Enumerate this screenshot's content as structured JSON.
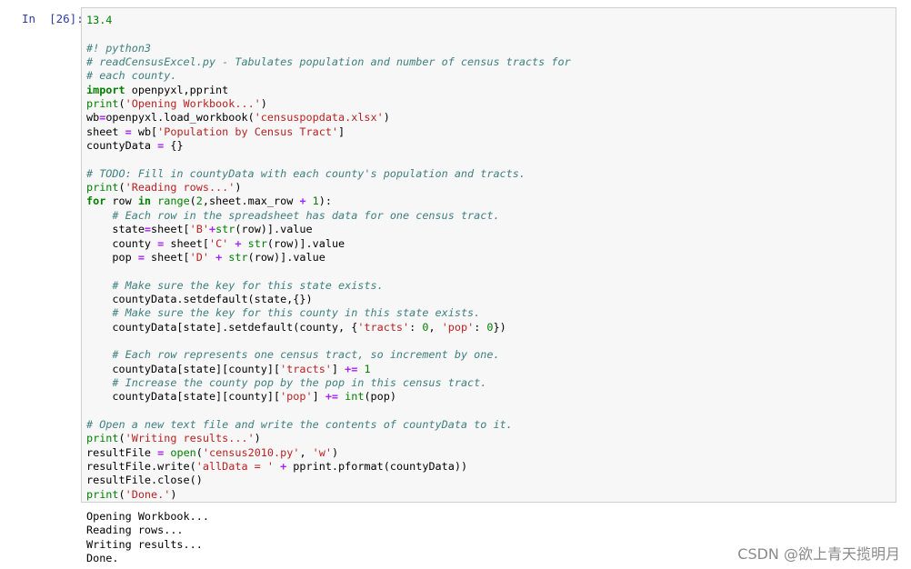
{
  "cell": {
    "prompt": "In  [26]:",
    "code_lines": [
      [
        {
          "t": "nu",
          "v": "13.4"
        }
      ],
      [],
      [
        {
          "t": "cm",
          "v": "#! python3"
        }
      ],
      [
        {
          "t": "cm",
          "v": "# readCensusExcel.py - Tabulates population and number of census tracts for"
        }
      ],
      [
        {
          "t": "cm",
          "v": "# each county."
        }
      ],
      [
        {
          "t": "kw",
          "v": "import"
        },
        {
          "t": "tx",
          "v": " openpyxl,pprint"
        }
      ],
      [
        {
          "t": "bi",
          "v": "print"
        },
        {
          "t": "tx",
          "v": "("
        },
        {
          "t": "st",
          "v": "'Opening Workbook...'"
        },
        {
          "t": "tx",
          "v": ")"
        }
      ],
      [
        {
          "t": "tx",
          "v": "wb"
        },
        {
          "t": "op",
          "v": "="
        },
        {
          "t": "tx",
          "v": "openpyxl.load_workbook("
        },
        {
          "t": "st",
          "v": "'censuspopdata.xlsx'"
        },
        {
          "t": "tx",
          "v": ")"
        }
      ],
      [
        {
          "t": "tx",
          "v": "sheet "
        },
        {
          "t": "op",
          "v": "="
        },
        {
          "t": "tx",
          "v": " wb["
        },
        {
          "t": "st",
          "v": "'Population by Census Tract'"
        },
        {
          "t": "tx",
          "v": "]"
        }
      ],
      [
        {
          "t": "tx",
          "v": "countyData "
        },
        {
          "t": "op",
          "v": "="
        },
        {
          "t": "tx",
          "v": " {}"
        }
      ],
      [],
      [
        {
          "t": "cm",
          "v": "# TODO: Fill in countyData with each county's population and tracts."
        }
      ],
      [
        {
          "t": "bi",
          "v": "print"
        },
        {
          "t": "tx",
          "v": "("
        },
        {
          "t": "st",
          "v": "'Reading rows...'"
        },
        {
          "t": "tx",
          "v": ")"
        }
      ],
      [
        {
          "t": "kw",
          "v": "for"
        },
        {
          "t": "tx",
          "v": " row "
        },
        {
          "t": "kw",
          "v": "in"
        },
        {
          "t": "tx",
          "v": " "
        },
        {
          "t": "bi",
          "v": "range"
        },
        {
          "t": "tx",
          "v": "("
        },
        {
          "t": "nu",
          "v": "2"
        },
        {
          "t": "tx",
          "v": ",sheet.max_row "
        },
        {
          "t": "op",
          "v": "+"
        },
        {
          "t": "tx",
          "v": " "
        },
        {
          "t": "nu",
          "v": "1"
        },
        {
          "t": "tx",
          "v": "):"
        }
      ],
      [
        {
          "t": "tx",
          "v": "    "
        },
        {
          "t": "cm",
          "v": "# Each row in the spreadsheet has data for one census tract."
        }
      ],
      [
        {
          "t": "tx",
          "v": "    state"
        },
        {
          "t": "op",
          "v": "="
        },
        {
          "t": "tx",
          "v": "sheet["
        },
        {
          "t": "st",
          "v": "'B'"
        },
        {
          "t": "op",
          "v": "+"
        },
        {
          "t": "bi",
          "v": "str"
        },
        {
          "t": "tx",
          "v": "(row)].value"
        }
      ],
      [
        {
          "t": "tx",
          "v": "    county "
        },
        {
          "t": "op",
          "v": "="
        },
        {
          "t": "tx",
          "v": " sheet["
        },
        {
          "t": "st",
          "v": "'C'"
        },
        {
          "t": "tx",
          "v": " "
        },
        {
          "t": "op",
          "v": "+"
        },
        {
          "t": "tx",
          "v": " "
        },
        {
          "t": "bi",
          "v": "str"
        },
        {
          "t": "tx",
          "v": "(row)].value"
        }
      ],
      [
        {
          "t": "tx",
          "v": "    pop "
        },
        {
          "t": "op",
          "v": "="
        },
        {
          "t": "tx",
          "v": " sheet["
        },
        {
          "t": "st",
          "v": "'D'"
        },
        {
          "t": "tx",
          "v": " "
        },
        {
          "t": "op",
          "v": "+"
        },
        {
          "t": "tx",
          "v": " "
        },
        {
          "t": "bi",
          "v": "str"
        },
        {
          "t": "tx",
          "v": "(row)].value"
        }
      ],
      [],
      [
        {
          "t": "tx",
          "v": "    "
        },
        {
          "t": "cm",
          "v": "# Make sure the key for this state exists."
        }
      ],
      [
        {
          "t": "tx",
          "v": "    countyData.setdefault(state,{})"
        }
      ],
      [
        {
          "t": "tx",
          "v": "    "
        },
        {
          "t": "cm",
          "v": "# Make sure the key for this county in this state exists."
        }
      ],
      [
        {
          "t": "tx",
          "v": "    countyData[state].setdefault(county, {"
        },
        {
          "t": "st",
          "v": "'tracts'"
        },
        {
          "t": "tx",
          "v": ": "
        },
        {
          "t": "nu",
          "v": "0"
        },
        {
          "t": "tx",
          "v": ", "
        },
        {
          "t": "st",
          "v": "'pop'"
        },
        {
          "t": "tx",
          "v": ": "
        },
        {
          "t": "nu",
          "v": "0"
        },
        {
          "t": "tx",
          "v": "})"
        }
      ],
      [],
      [
        {
          "t": "tx",
          "v": "    "
        },
        {
          "t": "cm",
          "v": "# Each row represents one census tract, so increment by one."
        }
      ],
      [
        {
          "t": "tx",
          "v": "    countyData[state][county]["
        },
        {
          "t": "st",
          "v": "'tracts'"
        },
        {
          "t": "tx",
          "v": "] "
        },
        {
          "t": "op",
          "v": "+="
        },
        {
          "t": "tx",
          "v": " "
        },
        {
          "t": "nu",
          "v": "1"
        }
      ],
      [
        {
          "t": "tx",
          "v": "    "
        },
        {
          "t": "cm",
          "v": "# Increase the county pop by the pop in this census tract."
        }
      ],
      [
        {
          "t": "tx",
          "v": "    countyData[state][county]["
        },
        {
          "t": "st",
          "v": "'pop'"
        },
        {
          "t": "tx",
          "v": "] "
        },
        {
          "t": "op",
          "v": "+="
        },
        {
          "t": "tx",
          "v": " "
        },
        {
          "t": "bi",
          "v": "int"
        },
        {
          "t": "tx",
          "v": "(pop)"
        }
      ],
      [],
      [
        {
          "t": "cm",
          "v": "# Open a new text file and write the contents of countyData to it."
        }
      ],
      [
        {
          "t": "bi",
          "v": "print"
        },
        {
          "t": "tx",
          "v": "("
        },
        {
          "t": "st",
          "v": "'Writing results...'"
        },
        {
          "t": "tx",
          "v": ")"
        }
      ],
      [
        {
          "t": "tx",
          "v": "resultFile "
        },
        {
          "t": "op",
          "v": "="
        },
        {
          "t": "tx",
          "v": " "
        },
        {
          "t": "bi",
          "v": "open"
        },
        {
          "t": "tx",
          "v": "("
        },
        {
          "t": "st",
          "v": "'census2010.py'"
        },
        {
          "t": "tx",
          "v": ", "
        },
        {
          "t": "st",
          "v": "'w'"
        },
        {
          "t": "tx",
          "v": ")"
        }
      ],
      [
        {
          "t": "tx",
          "v": "resultFile.write("
        },
        {
          "t": "st",
          "v": "'allData = '"
        },
        {
          "t": "tx",
          "v": " "
        },
        {
          "t": "op",
          "v": "+"
        },
        {
          "t": "tx",
          "v": " pprint.pformat(countyData))"
        }
      ],
      [
        {
          "t": "tx",
          "v": "resultFile.close()"
        }
      ],
      [
        {
          "t": "bi",
          "v": "print"
        },
        {
          "t": "tx",
          "v": "("
        },
        {
          "t": "st",
          "v": "'Done.'"
        },
        {
          "t": "tx",
          "v": ")"
        }
      ]
    ],
    "output_lines": [
      "Opening Workbook...",
      "Reading rows...",
      "Writing results...",
      "Done."
    ]
  },
  "watermark": "CSDN @欲上青天揽明月",
  "colors": {
    "prompt": "#303f9f",
    "comment": "#408080",
    "keyword": "#008000",
    "string": "#ba2121",
    "operator": "#aa22ff",
    "cell_background": "#f7f7f7",
    "cell_border": "#cfcfcf"
  }
}
